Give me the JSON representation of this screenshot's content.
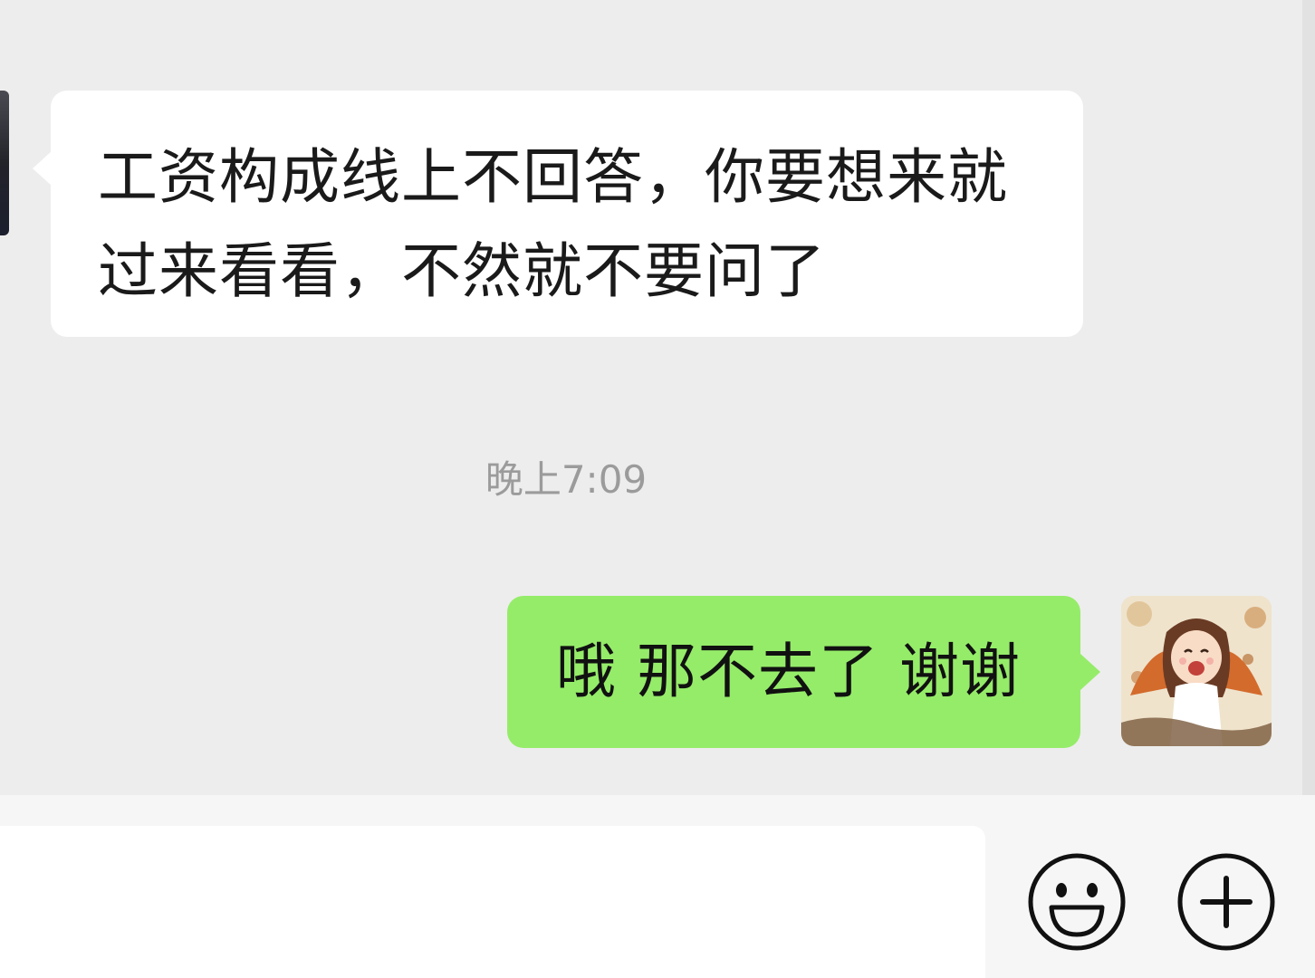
{
  "messages": [
    {
      "side": "left",
      "lines": [
        "工资构成线上不回答，你要想来就",
        "过来看看，不然就不要问了"
      ]
    },
    {
      "side": "right",
      "text": "哦 那不去了 谢谢"
    }
  ],
  "timestamp": "晚上7:09",
  "input_bar": {
    "placeholder": "",
    "emoji_icon": "smiley-face-icon",
    "more_icon": "plus-circle-icon"
  },
  "colors": {
    "chat_background": "#ededed",
    "incoming_bubble": "#ffffff",
    "outgoing_bubble": "#95ec69",
    "timestamp_text": "#9b9b9b"
  }
}
